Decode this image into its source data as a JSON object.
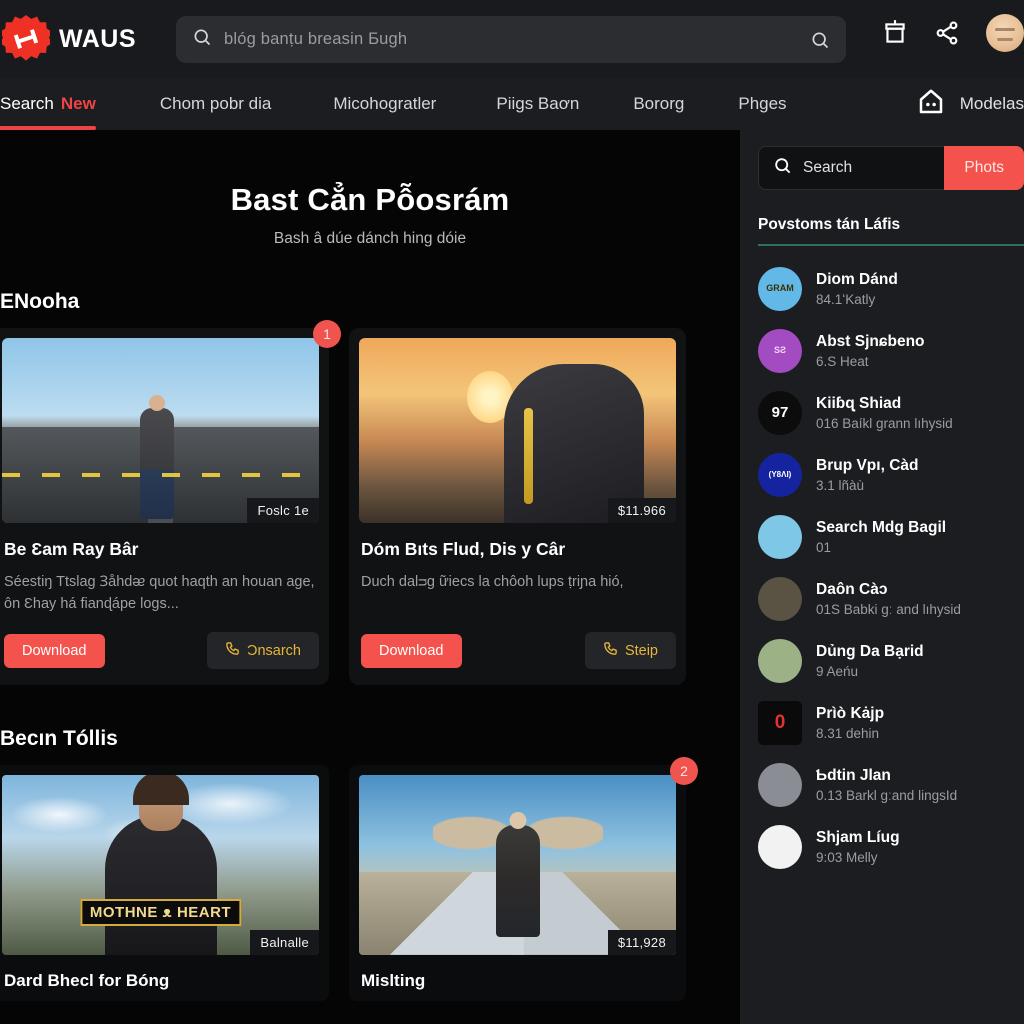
{
  "brand": {
    "name": "WAUS",
    "logo_icon": "starburst-logo-icon",
    "accent": "#ee3124"
  },
  "search": {
    "icon": "search-icon",
    "value": "blóg banṭu breasin Ƃugh",
    "submit_icon": "search-submit-icon"
  },
  "top_actions": [
    {
      "name": "archive-box-icon",
      "icon": "archive-box-icon"
    },
    {
      "name": "share-icon",
      "icon": "share-icon"
    },
    {
      "name": "avatar",
      "icon": "user-avatar"
    }
  ],
  "nav": {
    "items": [
      {
        "label": "Search",
        "badge": "New",
        "active": true
      },
      {
        "label": "Chom pobr dia",
        "active": false
      },
      {
        "label": "Micohogratler",
        "active": false
      },
      {
        "label": "Piigs Baơn",
        "active": false
      },
      {
        "label": "Bororg",
        "active": false
      },
      {
        "label": "Phges",
        "active": false
      }
    ],
    "trailing": {
      "icon": "house-robot-icon",
      "label": "Modelas"
    }
  },
  "hero": {
    "title": "Bast Cẳn Pỗosrám",
    "subtitle": "Bash â dúe dánch hing dóie"
  },
  "sections": [
    {
      "title": "ENooha",
      "cards": [
        {
          "badge": "1",
          "thumb_tag": "Foslc 1e",
          "art": "city-street",
          "title": "Be Ɛam Ray Bâr",
          "desc": "Séestiŋ Ttslag Ɜåhdᴂ quot haqth an houan age, ôn Ɛhay há fianɖápe logs...",
          "primary_label": "Download",
          "secondary_label": "Ɔnsarch",
          "secondary_icon": "phone-icon"
        },
        {
          "badge": "",
          "thumb_tag": "$11.966",
          "art": "dusk-soldier",
          "title": "Dóm Bıts Flud, Dis y Câr",
          "desc": "Duch dalᴝg ữiecs la chôoh lups ṭriɲa hió,",
          "primary_label": "Download",
          "secondary_label": "Steip",
          "secondary_icon": "phone-icon"
        }
      ]
    },
    {
      "title": "Becın Tóllis",
      "cards": [
        {
          "badge": "",
          "thumb_tag": "Balnalle",
          "art": "agent-woman",
          "overlay_logo": "MOTHNE ᴥ HEART",
          "title": "Dard Bhecl for Bóng"
        },
        {
          "badge": "2",
          "thumb_tag": "$11,928",
          "art": "winged-hero",
          "title": "Mislting"
        }
      ]
    }
  ],
  "sidebar": {
    "search": {
      "icon": "search-icon",
      "placeholder": "Search",
      "button_label": "Phots"
    },
    "heading": "Povstoms tán Láfis",
    "rule_color": "#2f6f68",
    "items": [
      {
        "title": "Diom Dánd",
        "sub": "84.1ʻKatly",
        "av_bg": "#62b9e8",
        "av_fg": "#e9c53a",
        "av_text": "GRAM",
        "shape": "circle"
      },
      {
        "title": "Abst Sjnɕbeno",
        "sub": "6.S Heat",
        "av_bg": "#a34bc0",
        "av_fg": "#f2d6ff",
        "av_text": "SƧ",
        "shape": "circle"
      },
      {
        "title": "Kiiɓɋ Shiad",
        "sub": "016 Baíkl grann lıhysid",
        "av_bg": "#0c0c0c",
        "av_fg": "#ffffff",
        "av_text": "97",
        "shape": "circle"
      },
      {
        "title": "Brup Vpı, Càd",
        "sub": "3.1 lñàù",
        "av_bg": "#15249e",
        "av_fg": "#ffffff",
        "av_text": "(Y8ΛI)",
        "shape": "circle"
      },
      {
        "title": "Search Mdɡ Bagil",
        "sub": "01",
        "av_bg": "#7fc7e6",
        "av_fg": "#3b2a1e",
        "av_text": "",
        "shape": "circle"
      },
      {
        "title": "Daôn Càɔ",
        "sub": "01S Babki gː and lıhysid",
        "av_bg": "#5a5243",
        "av_fg": "#e2c373",
        "av_text": "",
        "shape": "circle"
      },
      {
        "title": "Dủng Da Bạrid",
        "sub": "9 Aeńu",
        "av_bg": "#9cb286",
        "av_fg": "#edf2e6",
        "av_text": "",
        "shape": "circle"
      },
      {
        "title": "Prìò Kȧjp",
        "sub": "8.31 dehin",
        "av_bg": "#0a0a0a",
        "av_fg": "#e0342f",
        "av_text": "0",
        "shape": "square"
      },
      {
        "title": "Ƅdtin Jlan",
        "sub": "0.13 Barkl gːand lingsId",
        "av_bg": "#8a8d94",
        "av_fg": "#f0d9c0",
        "av_text": "",
        "shape": "circle"
      },
      {
        "title": "Shjam Líug",
        "sub": "9:03 Melly",
        "av_bg": "#f2f2f2",
        "av_fg": "#d8352f",
        "av_text": "",
        "shape": "circle"
      }
    ]
  }
}
